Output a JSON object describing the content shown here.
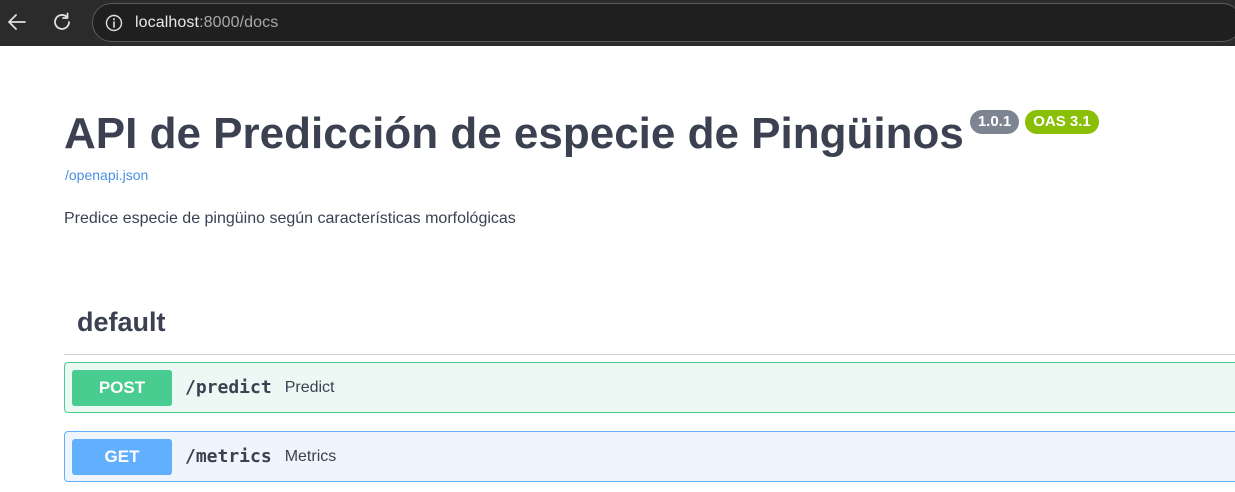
{
  "browser": {
    "url_host": "localhost",
    "url_rest": ":8000/docs"
  },
  "header": {
    "title": "API de Predicción de especie de Pingüinos",
    "version_badge": "1.0.1",
    "oas_badge": "OAS 3.1",
    "spec_link": "/openapi.json",
    "description": "Predice especie de pingüino según características morfológicas"
  },
  "section": {
    "title": "default"
  },
  "operations": [
    {
      "method": "POST",
      "path": "/predict",
      "summary": "Predict"
    },
    {
      "method": "GET",
      "path": "/metrics",
      "summary": "Metrics"
    }
  ],
  "colors": {
    "post": "#49cc90",
    "get": "#61affe",
    "title_text": "#3b4151",
    "link": "#4990e2",
    "oas_badge": "#89bf04",
    "version_badge": "#7d8492"
  }
}
